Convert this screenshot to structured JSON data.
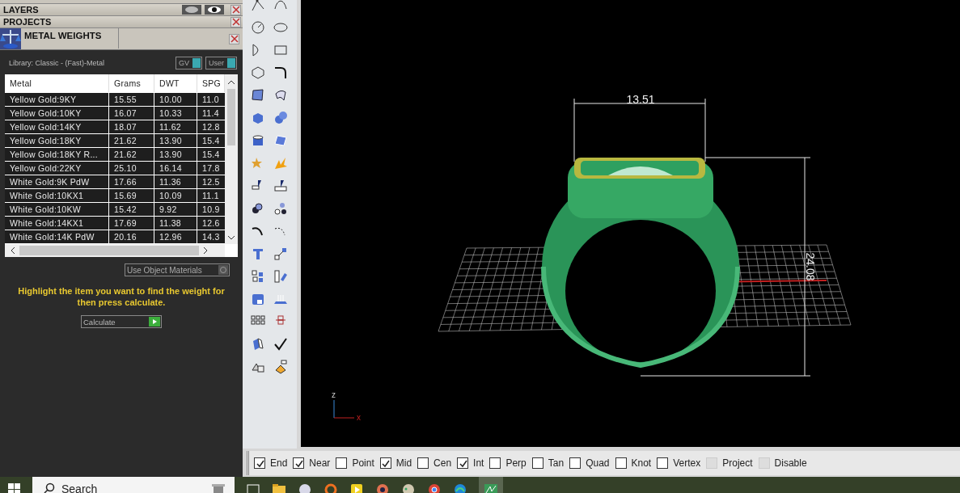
{
  "panels": [
    {
      "title": "LAYERS",
      "kind": "layers"
    },
    {
      "title": "PROJECTS",
      "kind": "plain"
    }
  ],
  "metal_weights": {
    "title": "METAL WEIGHTS",
    "library": "Library: Classic - (Fast)-Metal",
    "toggles": [
      {
        "label": "GV",
        "on": true
      },
      {
        "label": "User",
        "on": true
      }
    ],
    "table": {
      "columns": [
        "Metal",
        "Grams",
        "DWT",
        "SPG"
      ],
      "rows": [
        [
          "Yellow Gold:9KY",
          "15.55",
          "10.00",
          "11.0"
        ],
        [
          "Yellow Gold:10KY",
          "16.07",
          "10.33",
          "11.4"
        ],
        [
          "Yellow Gold:14KY",
          "18.07",
          "11.62",
          "12.8"
        ],
        [
          "Yellow Gold:18KY",
          "21.62",
          "13.90",
          "15.4"
        ],
        [
          "Yellow Gold:18KY R...",
          "21.62",
          "13.90",
          "15.4"
        ],
        [
          "Yellow Gold:22KY",
          "25.10",
          "16.14",
          "17.8"
        ],
        [
          "White Gold:9K PdW",
          "17.66",
          "11.36",
          "12.5"
        ],
        [
          "White Gold:10KX1",
          "15.69",
          "10.09",
          "11.1"
        ],
        [
          "White Gold:10KW",
          "15.42",
          "9.92",
          "10.9"
        ],
        [
          "White Gold:14KX1",
          "17.69",
          "11.38",
          "12.6"
        ],
        [
          "White Gold:14K PdW",
          "20.16",
          "12.96",
          "14.3"
        ]
      ]
    },
    "use_object_materials": {
      "label": "Use Object Materials",
      "checked": false
    },
    "hint": "Highlight the item you want to find the weight for then press calculate.",
    "calculate": "Calculate"
  },
  "viewport": {
    "width_dimension": "13.51",
    "height_dimension": "24.08",
    "axis_z": "z",
    "axis_x": "x"
  },
  "snaps": [
    {
      "label": "End",
      "checked": true,
      "disabled": false
    },
    {
      "label": "Near",
      "checked": true,
      "disabled": false
    },
    {
      "label": "Point",
      "checked": false,
      "disabled": false
    },
    {
      "label": "Mid",
      "checked": true,
      "disabled": false
    },
    {
      "label": "Cen",
      "checked": false,
      "disabled": false
    },
    {
      "label": "Int",
      "checked": true,
      "disabled": false
    },
    {
      "label": "Perp",
      "checked": false,
      "disabled": false
    },
    {
      "label": "Tan",
      "checked": false,
      "disabled": false
    },
    {
      "label": "Quad",
      "checked": false,
      "disabled": false
    },
    {
      "label": "Knot",
      "checked": false,
      "disabled": false
    },
    {
      "label": "Vertex",
      "checked": false,
      "disabled": false
    },
    {
      "label": "Project",
      "checked": false,
      "disabled": true
    },
    {
      "label": "Disable",
      "checked": false,
      "disabled": true
    }
  ],
  "taskbar": {
    "search": {
      "placeholder": "Search"
    }
  }
}
